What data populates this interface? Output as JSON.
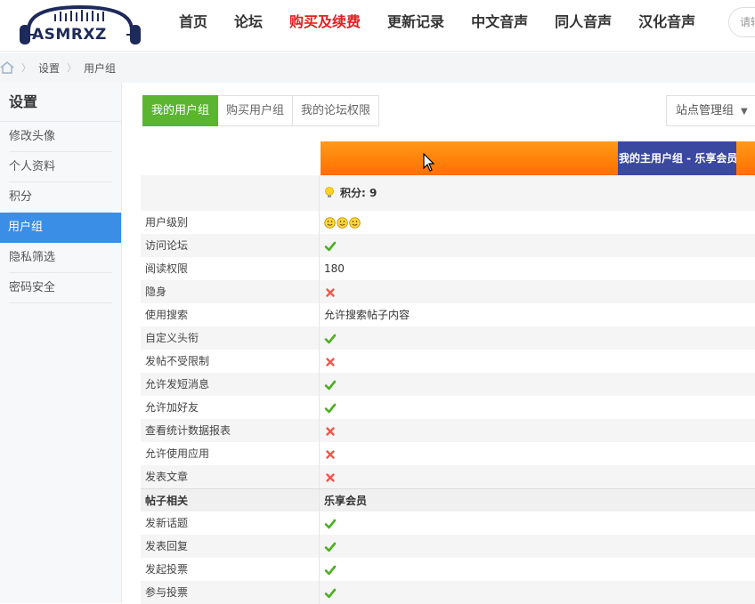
{
  "header": {
    "logo_text": "ASMRXZ",
    "nav": [
      {
        "label": "首页",
        "hot": false
      },
      {
        "label": "论坛",
        "hot": false
      },
      {
        "label": "购买及续费",
        "hot": true
      },
      {
        "label": "更新记录",
        "hot": false
      },
      {
        "label": "中文音声",
        "hot": false
      },
      {
        "label": "同人音声",
        "hot": false
      },
      {
        "label": "汉化音声",
        "hot": false
      }
    ],
    "search_placeholder": "请输"
  },
  "breadcrumb": {
    "items": [
      "设置",
      "用户组"
    ]
  },
  "sidebar": {
    "title": "设置",
    "items": [
      {
        "label": "修改头像",
        "active": false
      },
      {
        "label": "个人资料",
        "active": false
      },
      {
        "label": "积分",
        "active": false
      },
      {
        "label": "用户组",
        "active": true
      },
      {
        "label": "隐私筛选",
        "active": false
      },
      {
        "label": "密码安全",
        "active": false
      }
    ]
  },
  "tabs": [
    {
      "label": "我的用户组",
      "active": true
    },
    {
      "label": "购买用户组",
      "active": false
    },
    {
      "label": "我的论坛权限",
      "active": false
    }
  ],
  "admin_tab": {
    "label": "站点管理组"
  },
  "group_table": {
    "main_group_label": "我的主用户组 - 乐享会员",
    "points_label": "积分: 9",
    "rows": [
      {
        "label": "用户级别",
        "type": "stars",
        "count": 3
      },
      {
        "label": "访问论坛",
        "type": "yes"
      },
      {
        "label": "阅读权限",
        "type": "text",
        "value": "180"
      },
      {
        "label": "隐身",
        "type": "no"
      },
      {
        "label": "使用搜索",
        "type": "text",
        "value": "允许搜索帖子内容"
      },
      {
        "label": "自定义头衔",
        "type": "yes"
      },
      {
        "label": "发帖不受限制",
        "type": "no"
      },
      {
        "label": "允许发短消息",
        "type": "yes"
      },
      {
        "label": "允许加好友",
        "type": "yes"
      },
      {
        "label": "查看统计数据报表",
        "type": "no"
      },
      {
        "label": "允许使用应用",
        "type": "no"
      },
      {
        "label": "发表文章",
        "type": "no"
      }
    ],
    "section": {
      "label": "帖子相关",
      "value": "乐享会员"
    },
    "section_rows": [
      {
        "label": "发新话题",
        "type": "yes"
      },
      {
        "label": "发表回复",
        "type": "yes"
      },
      {
        "label": "发起投票",
        "type": "yes"
      },
      {
        "label": "参与投票",
        "type": "yes"
      }
    ]
  },
  "colors": {
    "accent_blue": "#3a8ee6",
    "tab_green": "#5cb531",
    "hot_red": "#e02020",
    "group_orange": "#ff7f00",
    "group_navy": "#3a48a0"
  }
}
